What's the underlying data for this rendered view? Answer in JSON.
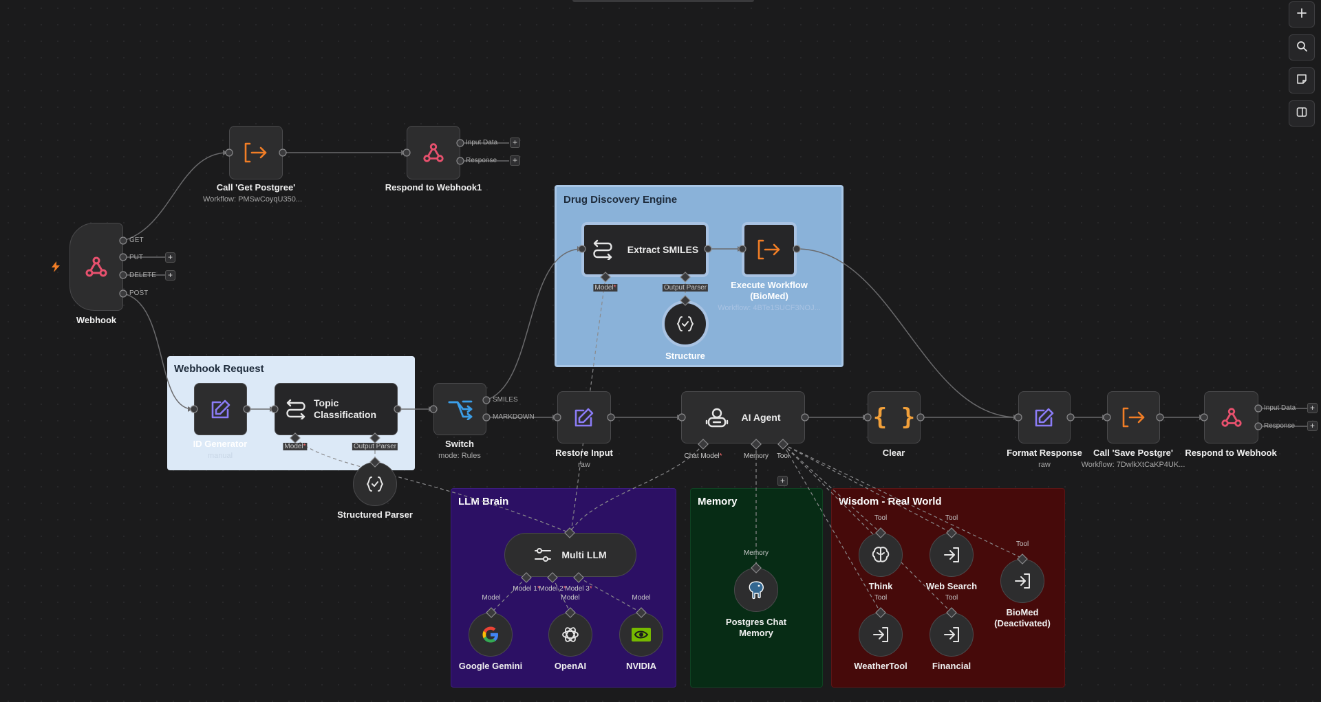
{
  "nodes": {
    "webhook": {
      "label": "Webhook",
      "outputs": [
        "GET",
        "PUT",
        "DELETE",
        "POST"
      ]
    },
    "call_get_postgree": {
      "label": "Call 'Get Postgree'",
      "sub": "Workflow: PMSwCoyqU350..."
    },
    "respond_webhook1": {
      "label": "Respond to Webhook1",
      "outputs": [
        "Input Data",
        "Response"
      ]
    },
    "id_generator": {
      "label": "ID Generator",
      "sub": "manual"
    },
    "topic_classification": {
      "label": "Topic Classification",
      "ports": [
        "Model",
        "Output Parser"
      ]
    },
    "structured_parser": {
      "label": "Structured Parser"
    },
    "switch": {
      "label": "Switch",
      "sub": "mode: Rules",
      "outputs": [
        "SMILES",
        "MARKDOWN"
      ]
    },
    "extract_smiles": {
      "label": "Extract SMILES",
      "ports": [
        "Model",
        "Output Parser"
      ]
    },
    "execute_workflow": {
      "label": "Execute Workflow (BioMed)",
      "sub": "Workflow: 4BTe1SUCF3NOJ..."
    },
    "structure": {
      "label": "Structure"
    },
    "restore_input": {
      "label": "Restore Input",
      "sub": "raw"
    },
    "ai_agent": {
      "label": "AI Agent",
      "ports": [
        "Chat Model",
        "Memory",
        "Tool"
      ]
    },
    "clear": {
      "label": "Clear"
    },
    "format_response": {
      "label": "Format Response",
      "sub": "raw"
    },
    "call_save_postgre": {
      "label": "Call 'Save Postgre'",
      "sub": "Workflow: 7DwlkXtCaKP4UK..."
    },
    "respond_webhook": {
      "label": "Respond to Webhook",
      "outputs": [
        "Input Data",
        "Response"
      ]
    },
    "multi_llm": {
      "label": "Multi LLM",
      "ports": [
        "Model 1",
        "Model 2",
        "Model 3"
      ]
    },
    "google_gemini": {
      "label": "Google Gemini",
      "port": "Model"
    },
    "openai": {
      "label": "OpenAI",
      "port": "Model"
    },
    "nvidia": {
      "label": "NVIDIA",
      "port": "Model"
    },
    "postgres_memory": {
      "label": "Postgres Chat Memory",
      "port": "Memory"
    },
    "think": {
      "label": "Think",
      "port": "Tool"
    },
    "web_search": {
      "label": "Web Search",
      "port": "Tool"
    },
    "biomed": {
      "label": "BioMed (Deactivated)",
      "port": "Tool"
    },
    "weathertool": {
      "label": "WeatherTool",
      "port": "Tool"
    },
    "financial": {
      "label": "Financial",
      "port": "Tool"
    }
  },
  "groups": {
    "drug_discovery": {
      "title": "Drug Discovery Engine",
      "color": "#8ab2d9"
    },
    "webhook_request": {
      "title": "Webhook Request",
      "color": "#dce9f7"
    },
    "llm_brain": {
      "title": "LLM Brain",
      "color": "#2c1064"
    },
    "memory": {
      "title": "Memory",
      "color": "#072c15"
    },
    "wisdom": {
      "title": "Wisdom - Real World",
      "color": "#460a0a"
    }
  },
  "toolbar": {
    "buttons": [
      "plus-icon",
      "search-icon",
      "sticky-note-icon",
      "panel-toggle-icon"
    ]
  },
  "icons": {
    "accent_orange": "#f27e26",
    "accent_pink": "#e8516e",
    "accent_purple": "#8b7cf6",
    "accent_blue": "#3b9ee8"
  }
}
